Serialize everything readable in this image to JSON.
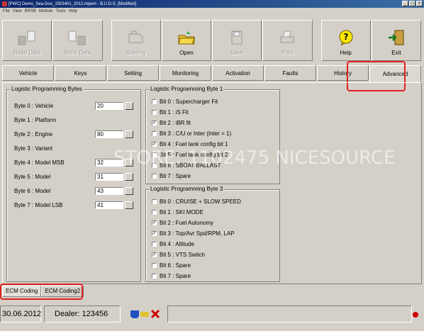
{
  "window": {
    "title": "[PWC] Demo_Sea-Doo_1503401_2012.mpem - B.U.D.S. [Modified]"
  },
  "menu": [
    "File",
    "View",
    "BRSB",
    "Module",
    "Tools",
    "Help"
  ],
  "toolbar": [
    {
      "label": "Read Data",
      "icon": "read-data-icon",
      "disabled": true
    },
    {
      "label": "Write Data",
      "icon": "write-data-icon",
      "disabled": true
    },
    {
      "label": "Starting",
      "icon": "engine-icon",
      "disabled": true
    },
    {
      "label": "Open",
      "icon": "open-folder-icon",
      "disabled": false
    },
    {
      "label": "Save",
      "icon": "save-disk-icon",
      "disabled": true
    },
    {
      "label": "Print",
      "icon": "printer-icon",
      "disabled": true
    },
    {
      "label": "Help",
      "icon": "help-icon",
      "disabled": false
    },
    {
      "label": "Exit",
      "icon": "exit-door-icon",
      "disabled": false
    }
  ],
  "tabs": [
    "Vehicle",
    "Keys",
    "Setting",
    "Monitoring",
    "Activation",
    "Faults",
    "History",
    "Advanced"
  ],
  "active_tab": "Advanced",
  "bytes_group": {
    "title": "Logistic Programming Bytes",
    "rows": [
      {
        "label": "Byte 0 : Vehicle",
        "value": "20"
      },
      {
        "label": "Byte 1 : Platform",
        "value": null
      },
      {
        "label": "Byte 2 : Engine",
        "value": "80"
      },
      {
        "label": "Byte 3 : Variant",
        "value": null
      },
      {
        "label": "Byte 4 : Model MSB",
        "value": "32"
      },
      {
        "label": "Byte 5 : Model",
        "value": "31"
      },
      {
        "label": "Byte 6 : Model",
        "value": "43"
      },
      {
        "label": "Byte 7 : Model LSB",
        "value": "41"
      }
    ]
  },
  "byte1_group": {
    "title": "Logistic Programming Byte 1",
    "bits": [
      {
        "label": "Bit 0 : Supercharger Fit",
        "checked": false
      },
      {
        "label": "Bit 1 : iS Fit",
        "checked": false
      },
      {
        "label": "Bit 2 : iBR fit",
        "checked": true
      },
      {
        "label": "Bit 3 : C/U or Inter (Inter = 1)",
        "checked": false
      },
      {
        "label": "Bit 4 : Fuel tank config bit 1",
        "checked": true
      },
      {
        "label": "Bit 5 : Fuel tank config bit 2",
        "checked": false
      },
      {
        "label": "Bit 6 : SBOAT BALLAST",
        "checked": false
      },
      {
        "label": "Bit 7 : Spare",
        "checked": false
      }
    ]
  },
  "byte3_group": {
    "title": "Logistic Programming Byte 3",
    "bits": [
      {
        "label": "Bit 0 : CRUISE + SLOW SPEED",
        "checked": false
      },
      {
        "label": "Bit 1 : SKI MODE",
        "checked": false
      },
      {
        "label": "Bit 2 : Fuel Autonomy",
        "checked": true
      },
      {
        "label": "Bit 3 : Top/Avr Spd/RPM, LAP",
        "checked": true
      },
      {
        "label": "Bit 4 : Altitude",
        "checked": false
      },
      {
        "label": "Bit 5 : VTS Switch",
        "checked": true
      },
      {
        "label": "Bit 6 : Spare",
        "checked": false
      },
      {
        "label": "Bit 7 : Spare",
        "checked": false
      }
    ]
  },
  "watermark": "STORE: 1102475 NICESOURCE",
  "bottom_tabs": [
    "ECM Coding",
    "ECM Coding2"
  ],
  "status": {
    "date": "30.06.2012",
    "dealer": "Dealer: 123456"
  },
  "colors": {
    "highlight": "#e02020",
    "title_bar": "#0a246a"
  }
}
